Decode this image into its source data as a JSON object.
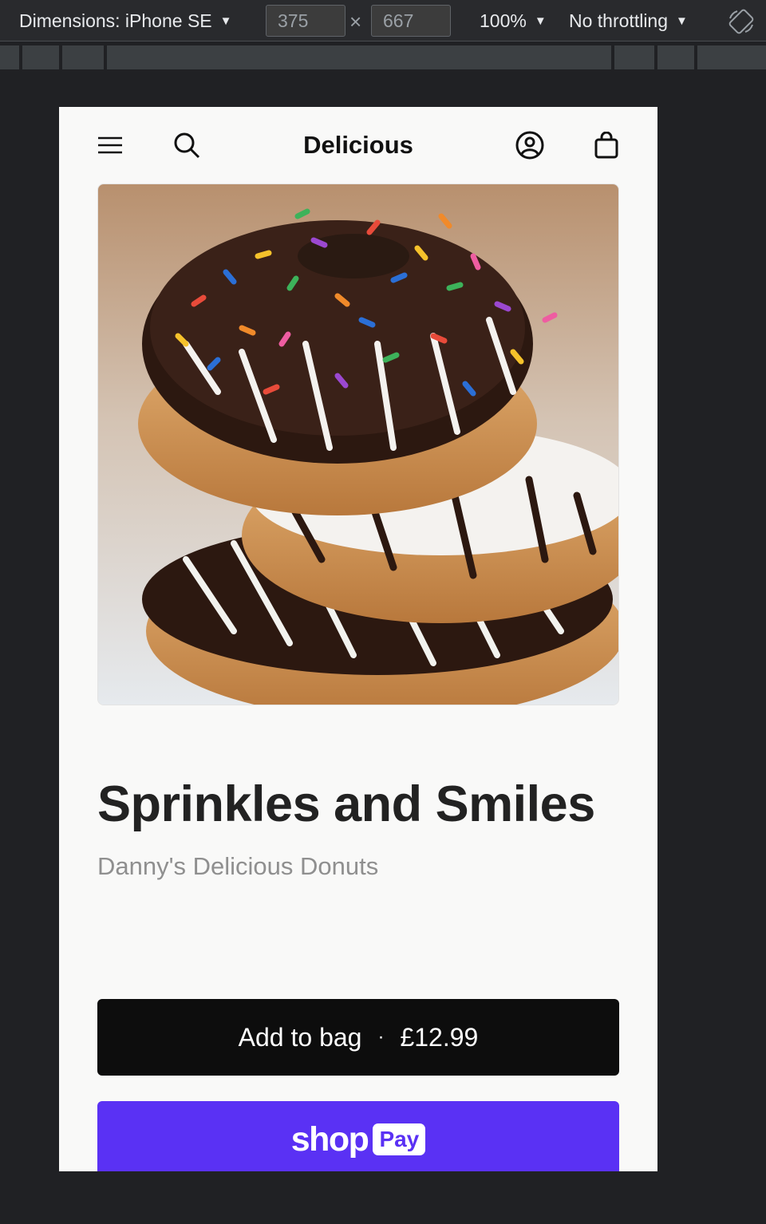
{
  "devtools": {
    "dimensions_label": "Dimensions: iPhone SE",
    "width_value": "375",
    "height_value": "667",
    "times_symbol": "×",
    "zoom_label": "100%",
    "throttling_label": "No throttling"
  },
  "header": {
    "store_name": "Delicious",
    "menu_icon": "hamburger-menu-icon",
    "search_icon": "search-icon",
    "account_icon": "account-icon",
    "bag_icon": "shopping-bag-icon"
  },
  "product": {
    "title": "Sprinkles and Smiles",
    "vendor": "Danny's Delicious Donuts",
    "add_to_bag_label": "Add to bag",
    "separator": "·",
    "price": "£12.99"
  },
  "shop_pay": {
    "shop_text": "shop",
    "pay_text": "Pay",
    "brand_color": "#5a31f4"
  },
  "colors": {
    "devtools_bg": "#292a2d",
    "page_bg": "#f9f9f8",
    "primary_button": "#0d0d0d"
  }
}
